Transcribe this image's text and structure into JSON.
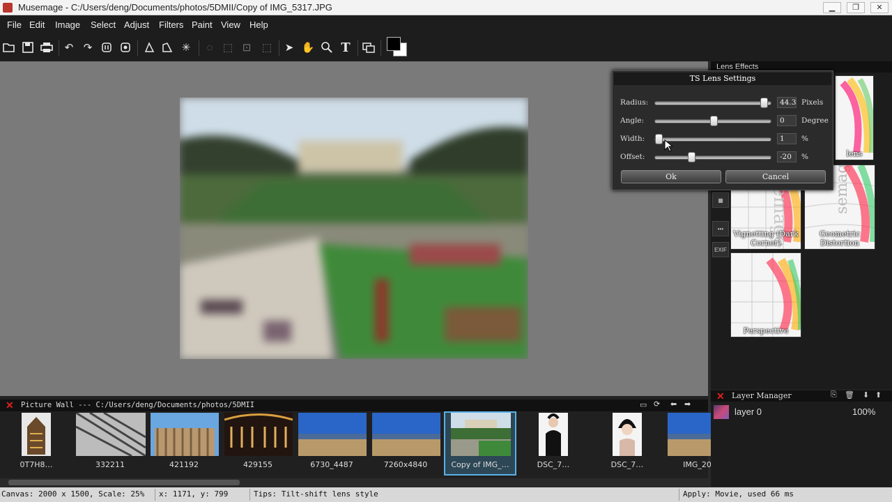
{
  "window": {
    "title": "Musemage - C:/Users/deng/Documents/photos/5DMII/Copy of IMG_5317.JPG",
    "controls": [
      "minimize",
      "restore",
      "close"
    ]
  },
  "menu": [
    "File",
    "Edit",
    "Image",
    "Select",
    "Adjust",
    "Filters",
    "Paint",
    "View",
    "Help"
  ],
  "toolbar": {
    "tools": [
      "open-icon",
      "save-icon",
      "print-icon",
      "undo-icon",
      "redo-icon",
      "history-icon",
      "history-alt-icon",
      "crop-icon",
      "transform-icon",
      "magic-icon",
      "lasso-icon",
      "rect-select-icon",
      "ellipse-select-icon",
      "select-options-icon",
      "pointer-icon",
      "hand-icon",
      "zoom-icon",
      "text-icon",
      "layers-icon"
    ],
    "text_tool_label": "T",
    "foreground_color": "#000000",
    "background_color": "#ffffff"
  },
  "lens_panel": {
    "title": "Lens Effects",
    "side_icons": [
      "grid-icon",
      "more-icon",
      "exif-icon"
    ],
    "exif_label": "EXIF",
    "thumbnails": [
      {
        "label": "lens"
      },
      {
        "label": "Vignetting (Dark Corner)"
      },
      {
        "label": "Geometric Distortion"
      },
      {
        "label": "Perspective"
      }
    ],
    "watermark": "Musemage"
  },
  "dialog": {
    "title": "TS Lens Settings",
    "rows": [
      {
        "label": "Radius:",
        "value": "44.3",
        "unit": "Pixels",
        "level": 0.96
      },
      {
        "label": "Angle:",
        "value": "0",
        "unit": "Degree",
        "level": 0.5
      },
      {
        "label": "Width:",
        "value": "1",
        "unit": "%",
        "level": 0.0
      },
      {
        "label": "Offset:",
        "value": "-20",
        "unit": "%",
        "level": 0.3
      }
    ],
    "ok_label": "Ok",
    "cancel_label": "Cancel"
  },
  "picture_wall": {
    "title": "Picture Wall --- C:/Users/deng/Documents/photos/5DMII",
    "items": [
      {
        "caption": "0T7H8…",
        "scene": "building"
      },
      {
        "caption": "332211",
        "scene": "hall"
      },
      {
        "caption": "421192",
        "scene": "temple"
      },
      {
        "caption": "429155",
        "scene": "stage"
      },
      {
        "caption": "6730_4487",
        "scene": "desert"
      },
      {
        "caption": "7260x4840",
        "scene": "desert"
      },
      {
        "caption": "Copy of IMG_…",
        "scene": "garden",
        "selected": true
      },
      {
        "caption": "DSC_7…",
        "scene": "portrait"
      },
      {
        "caption": "DSC_7…",
        "scene": "portrait2"
      },
      {
        "caption": "IMG_20…",
        "scene": "desert"
      }
    ]
  },
  "layer_manager": {
    "title": "Layer Manager",
    "layers": [
      {
        "name": "layer 0",
        "opacity": "100%"
      }
    ]
  },
  "status": {
    "canvas": "Canvas: 2000 x 1500, Scale: 25%",
    "cursor": "x: 1171, y: 799",
    "tips": "Tips: Tilt-shift lens style",
    "apply": "Apply: Movie, used 66 ms"
  },
  "colors": {
    "accent": "#5ab0e6",
    "close_red": "#e02020"
  }
}
